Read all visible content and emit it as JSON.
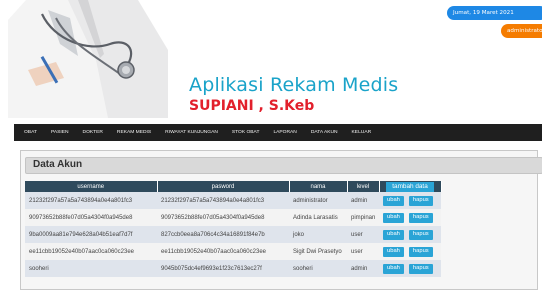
{
  "header": {
    "app_title": "Aplikasi Rekam Medis",
    "subtitle": "SUPIANI , S.Keb",
    "date": "Jumat, 19 Maret 2021",
    "user": "administrator",
    "date_color": "#1e88e5",
    "user_color": "#f57c00",
    "title_color": "#1aa3c9",
    "subtitle_color": "#e2202c"
  },
  "nav": {
    "items": [
      "OBAT",
      "PASIEN",
      "DOKTER",
      "REKAM MEDIS",
      "RIWAYAT KUNJUNGAN",
      "STOK OBAT",
      "LAPORAN",
      "DATA AKUN",
      "KELUAR"
    ]
  },
  "panel": {
    "title": "Data Akun"
  },
  "table": {
    "headers": [
      "username",
      "pasword",
      "nama",
      "level"
    ],
    "add_label": "tambah data",
    "edit_label": "ubah",
    "delete_label": "hapus",
    "rows": [
      {
        "username": "21232f297a57a5a743894a0e4a801fc3",
        "password": "21232f297a57a5a743894a0e4a801fc3",
        "nama": "administrator",
        "level": "admin"
      },
      {
        "username": "90973652b88fe07d05a4304f0a945de8",
        "password": "90973652b88fe07d05a4304f0a945de8",
        "nama": "Adinda Larasatis",
        "level": "pimpinan"
      },
      {
        "username": "9ba0009aa81e794e628a04b51eaf7d7f",
        "password": "827ccb0eea8a706c4c34a16891f84e7b",
        "nama": "joko",
        "level": "user"
      },
      {
        "username": "ee11cbb19052e40b07aac0ca060c23ee",
        "password": "ee11cbb19052e40b07aac0ca060c23ee",
        "nama": "Sigit Dwi Prasetyo",
        "level": "user"
      },
      {
        "username": "sooheri",
        "password": "9045b075dc4ef9693e1f23c7613ec27f",
        "nama": "sooheri",
        "level": "admin"
      }
    ]
  }
}
